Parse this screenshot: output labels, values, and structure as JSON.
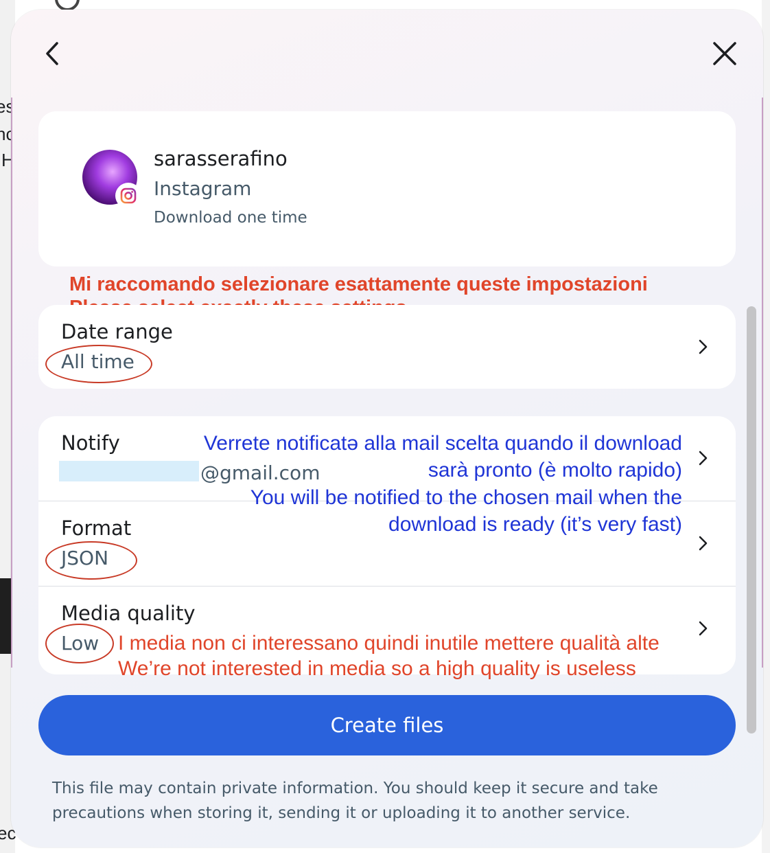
{
  "header": {
    "back_icon": "chevron-left-icon",
    "close_icon": "close-icon"
  },
  "account": {
    "username": "sarasserafino",
    "platform": "Instagram",
    "mode": "Download one time",
    "badge_icon": "instagram-icon"
  },
  "settings": {
    "date_range": {
      "label": "Date range",
      "value": "All time"
    },
    "notify": {
      "label": "Notify",
      "email_suffix": "@gmail.com"
    },
    "format": {
      "label": "Format",
      "value": "JSON"
    },
    "media_quality": {
      "label": "Media quality",
      "value": "Low"
    }
  },
  "footer": {
    "create_label": "Create files",
    "disclaimer": "This file may contain private information. You should keep it secure and take precautions when storing it, sending it or uploading it to another service."
  },
  "annotations": {
    "settings_it": "Mi raccomando selezionare esattamente queste impostazioni",
    "settings_en": "Please select exactly these settings",
    "notify_it_1": "Verrete notificatə alla mail scelta quando il download",
    "notify_it_2": "sarà pronto (è molto rapido)",
    "notify_en_1": "You will be notified to the chosen mail when the",
    "notify_en_2": "download is ready (it’s very fast)",
    "media_it": "I media non ci interessano quindi inutile mettere qualità alte",
    "media_en": "We’re not interested in media so a high quality is useless"
  },
  "background": {
    "frag_1": "es",
    "frag_2": "nc",
    "frag_3": "H",
    "frag_4": "ec"
  },
  "colors": {
    "primary": "#2a62dc",
    "annotation_red": "#e0452a",
    "annotation_blue": "#1f35d6"
  }
}
